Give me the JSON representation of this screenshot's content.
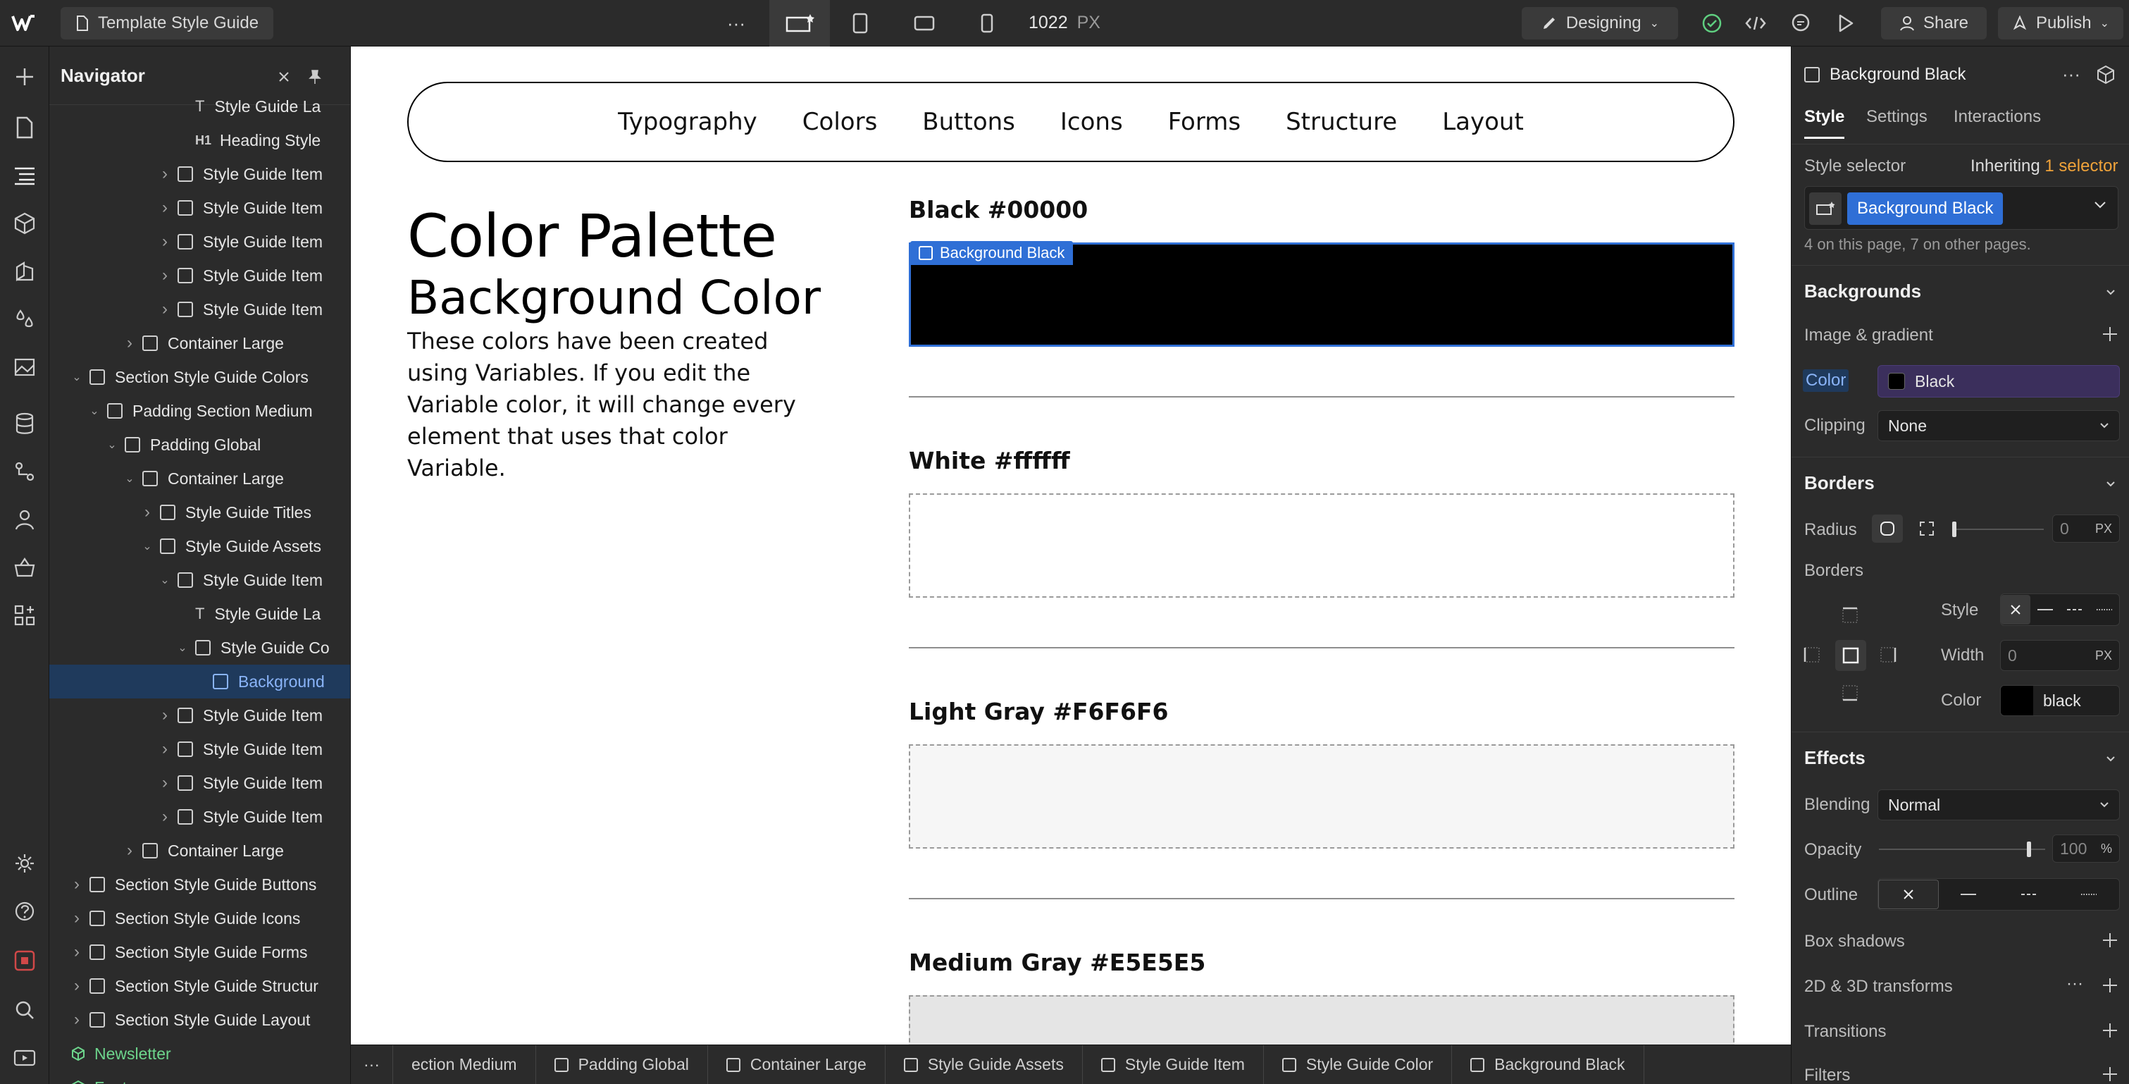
{
  "topbar": {
    "project_name": "Template Style Guide",
    "more_label": "···",
    "width_value": "1022",
    "width_unit": "PX",
    "mode_label": "Designing",
    "share_label": "Share",
    "publish_label": "Publish"
  },
  "navigator": {
    "title": "Navigator",
    "items": [
      {
        "label": "Style Guide La",
        "indent": 7,
        "kind": "text",
        "chev": "none"
      },
      {
        "label": "Heading Style",
        "indent": 7,
        "kind": "h1",
        "chev": "none"
      },
      {
        "label": "Style Guide Item",
        "indent": 6,
        "kind": "box",
        "chev": "right"
      },
      {
        "label": "Style Guide Item",
        "indent": 6,
        "kind": "box",
        "chev": "right"
      },
      {
        "label": "Style Guide Item",
        "indent": 6,
        "kind": "box",
        "chev": "right"
      },
      {
        "label": "Style Guide Item",
        "indent": 6,
        "kind": "box",
        "chev": "right"
      },
      {
        "label": "Style Guide Item",
        "indent": 6,
        "kind": "box",
        "chev": "right"
      },
      {
        "label": "Container Large",
        "indent": 4,
        "kind": "box",
        "chev": "right"
      },
      {
        "label": "Section Style Guide Colors",
        "indent": 1,
        "kind": "box",
        "chev": "down"
      },
      {
        "label": "Padding Section Medium",
        "indent": 2,
        "kind": "box",
        "chev": "down"
      },
      {
        "label": "Padding Global",
        "indent": 3,
        "kind": "box",
        "chev": "down"
      },
      {
        "label": "Container Large",
        "indent": 4,
        "kind": "box",
        "chev": "down"
      },
      {
        "label": "Style Guide Titles",
        "indent": 5,
        "kind": "box",
        "chev": "right"
      },
      {
        "label": "Style Guide Assets",
        "indent": 5,
        "kind": "box",
        "chev": "down"
      },
      {
        "label": "Style Guide Item",
        "indent": 6,
        "kind": "box",
        "chev": "down"
      },
      {
        "label": "Style Guide La",
        "indent": 7,
        "kind": "text",
        "chev": "none"
      },
      {
        "label": "Style Guide Co",
        "indent": 7,
        "kind": "box",
        "chev": "down"
      },
      {
        "label": "Background",
        "indent": 8,
        "kind": "box",
        "chev": "none",
        "selected": true
      },
      {
        "label": "Style Guide Item",
        "indent": 6,
        "kind": "box",
        "chev": "right"
      },
      {
        "label": "Style Guide Item",
        "indent": 6,
        "kind": "box",
        "chev": "right"
      },
      {
        "label": "Style Guide Item",
        "indent": 6,
        "kind": "box",
        "chev": "right"
      },
      {
        "label": "Style Guide Item",
        "indent": 6,
        "kind": "box",
        "chev": "right"
      },
      {
        "label": "Container Large",
        "indent": 4,
        "kind": "box",
        "chev": "right"
      },
      {
        "label": "Section Style Guide Buttons",
        "indent": 1,
        "kind": "box",
        "chev": "right"
      },
      {
        "label": "Section Style Guide Icons",
        "indent": 1,
        "kind": "box",
        "chev": "right"
      },
      {
        "label": "Section Style Guide Forms",
        "indent": 1,
        "kind": "box",
        "chev": "right"
      },
      {
        "label": "Section Style Guide Structur",
        "indent": 1,
        "kind": "box",
        "chev": "right"
      },
      {
        "label": "Section Style Guide Layout",
        "indent": 1,
        "kind": "box",
        "chev": "right"
      },
      {
        "label": "Newsletter",
        "indent": 0,
        "kind": "component",
        "chev": "none"
      },
      {
        "label": "Footer",
        "indent": 0,
        "kind": "component",
        "chev": "none"
      }
    ]
  },
  "canvas": {
    "nav_links": [
      "Typography",
      "Colors",
      "Buttons",
      "Icons",
      "Forms",
      "Structure",
      "Layout"
    ],
    "heading": "Color Palette",
    "subheading": "Background Color",
    "description": "These colors have been created using Variables. If you edit the Variable color, it will change every element that uses that color Variable.",
    "selected_tag": "Background Black",
    "swatches": [
      {
        "title": "Black #00000",
        "color": "#000000"
      },
      {
        "title": "White #ffffff",
        "color": "#ffffff"
      },
      {
        "title": "Light Gray #F6F6F6",
        "color": "#f6f6f6"
      },
      {
        "title": "Medium Gray  #E5E5E5",
        "color": "#e5e5e5"
      }
    ]
  },
  "breadcrumbs": [
    "ection Medium",
    "Padding Global",
    "Container Large",
    "Style Guide Assets",
    "Style Guide Item",
    "Style Guide Color",
    "Background Black"
  ],
  "panel": {
    "element_name": "Background Black",
    "tabs": [
      "Style",
      "Settings",
      "Interactions"
    ],
    "active_tab": "Style",
    "style_selector_label": "Style selector",
    "inheriting_label": "Inheriting",
    "inheriting_count": "1 selector",
    "selector_chip": "Background Black",
    "usage_note": "4 on this page, 7 on other pages.",
    "backgrounds": {
      "title": "Backgrounds",
      "image_gradient_label": "Image & gradient",
      "color_label": "Color",
      "color_value": "Black",
      "clipping_label": "Clipping",
      "clipping_value": "None"
    },
    "borders": {
      "title": "Borders",
      "radius_label": "Radius",
      "radius_value": "0",
      "radius_unit": "PX",
      "borders_label": "Borders",
      "style_label": "Style",
      "width_label": "Width",
      "width_value": "0",
      "width_unit": "PX",
      "color_label": "Color",
      "color_value": "black"
    },
    "effects": {
      "title": "Effects",
      "blending_label": "Blending",
      "blending_value": "Normal",
      "opacity_label": "Opacity",
      "opacity_value": "100",
      "opacity_unit": "%",
      "outline_label": "Outline",
      "box_shadows_label": "Box shadows",
      "transforms_label": "2D & 3D transforms",
      "transitions_label": "Transitions",
      "filters_label": "Filters"
    }
  },
  "colors": {
    "accent_blue": "#2f6fd6",
    "selection_bg": "#1f3a5c",
    "inheriting_orange": "#f0a33a",
    "component_green": "#6dd58c"
  }
}
